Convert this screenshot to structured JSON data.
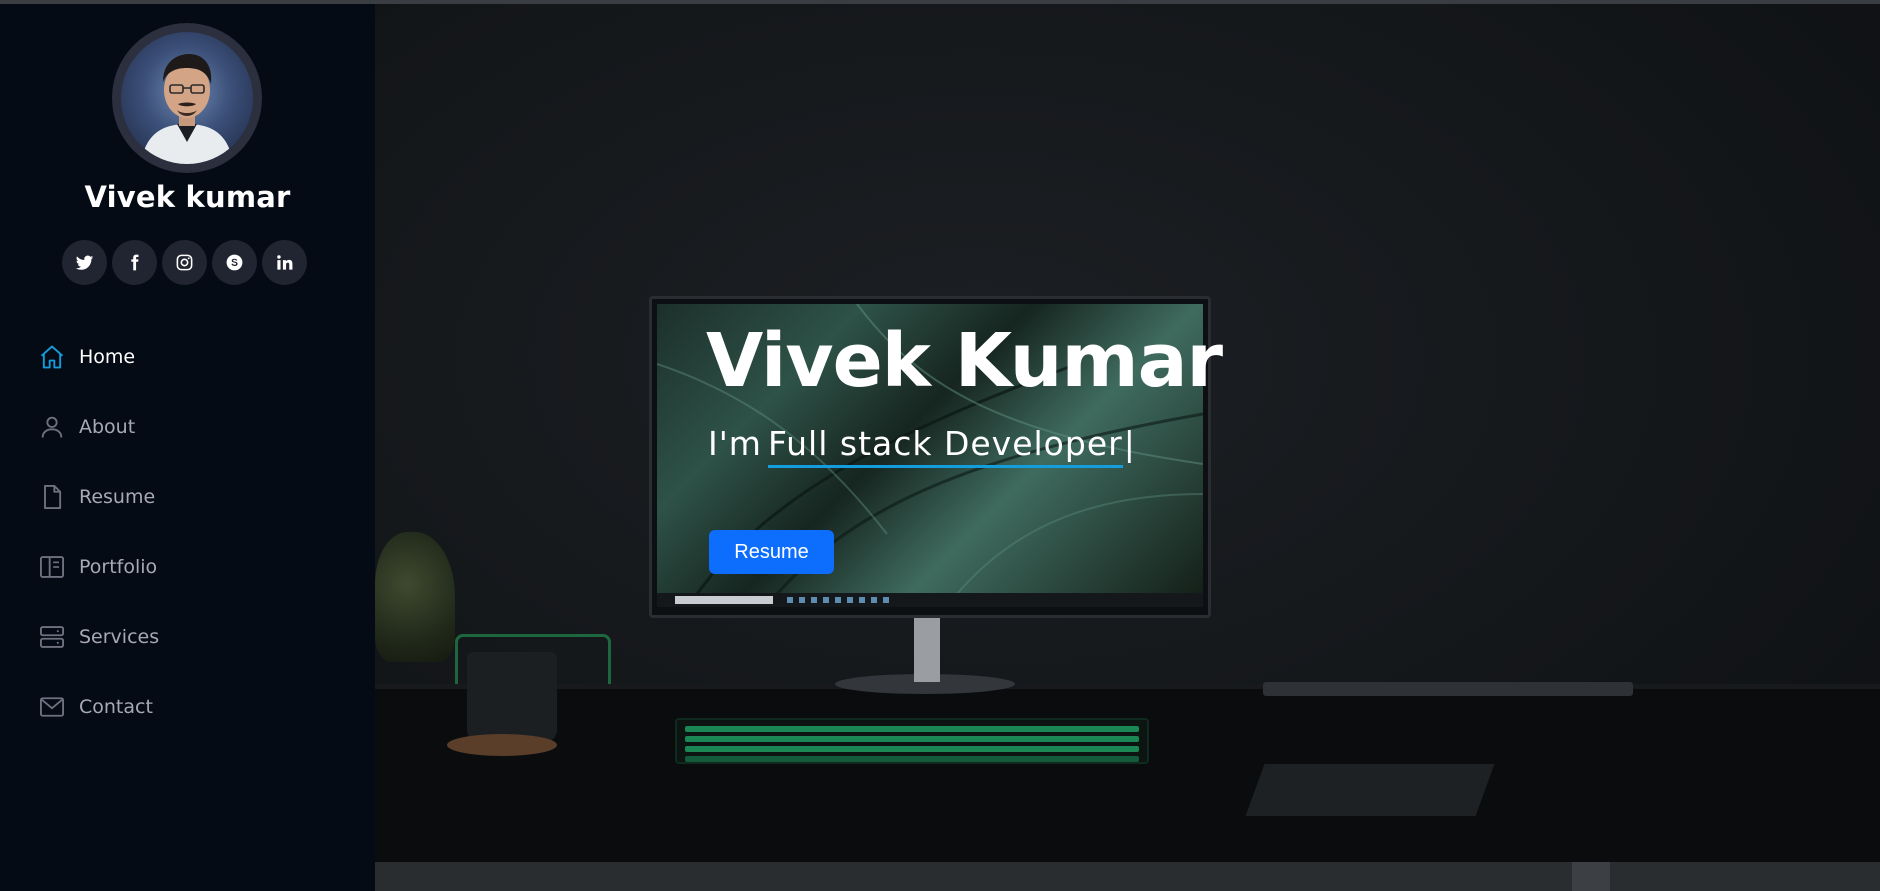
{
  "profile": {
    "name": "Vivek kumar",
    "avatar_icon": "person-photo"
  },
  "socials": [
    {
      "icon": "twitter-icon"
    },
    {
      "icon": "facebook-icon"
    },
    {
      "icon": "instagram-icon"
    },
    {
      "icon": "skype-icon"
    },
    {
      "icon": "linkedin-icon"
    }
  ],
  "nav": {
    "items": [
      {
        "label": "Home",
        "icon": "house-icon",
        "active": true
      },
      {
        "label": "About",
        "icon": "person-icon",
        "active": false
      },
      {
        "label": "Resume",
        "icon": "file-icon",
        "active": false
      },
      {
        "label": "Portfolio",
        "icon": "layout-icon",
        "active": false
      },
      {
        "label": "Services",
        "icon": "server-icon",
        "active": false
      },
      {
        "label": "Contact",
        "icon": "envelope-icon",
        "active": false
      }
    ]
  },
  "hero": {
    "title": "Vivek Kumar",
    "subtitle_prefix": "I'm",
    "subtitle_typed": "Full stack Developer",
    "cursor": "|",
    "resume_button": "Resume"
  },
  "colors": {
    "accent": "#149ddd",
    "button": "#0d6efd",
    "sidebar_bg": "#040b14",
    "nav_inactive": "#a8a9b4",
    "social_bg": "#212431"
  }
}
